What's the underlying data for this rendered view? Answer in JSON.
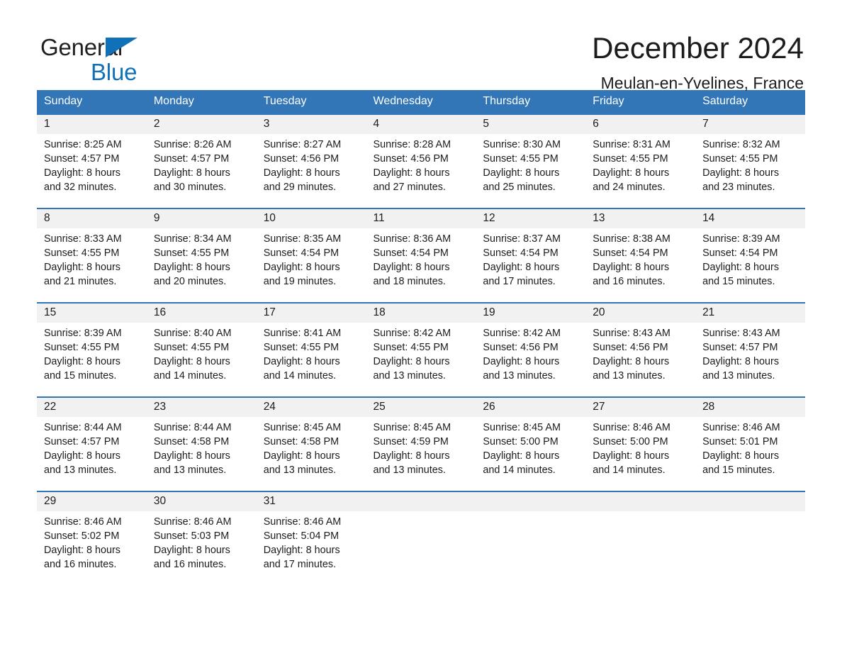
{
  "brand": {
    "line1": "General",
    "line2": "Blue",
    "triangle_icon": "triangle-icon",
    "accent_color": "#1070b8"
  },
  "header": {
    "month_title": "December 2024",
    "location": "Meulan-en-Yvelines, France"
  },
  "calendar": {
    "header_bg": "#3276b7",
    "daynum_bg": "#f1f1f1",
    "weekdays": [
      "Sunday",
      "Monday",
      "Tuesday",
      "Wednesday",
      "Thursday",
      "Friday",
      "Saturday"
    ],
    "labels": {
      "sunrise": "Sunrise:",
      "sunset": "Sunset:",
      "daylight": "Daylight:"
    },
    "weeks": [
      [
        {
          "day": "1",
          "sunrise": "Sunrise: 8:25 AM",
          "sunset": "Sunset: 4:57 PM",
          "daylight_line1": "Daylight: 8 hours",
          "daylight_line2": "and 32 minutes."
        },
        {
          "day": "2",
          "sunrise": "Sunrise: 8:26 AM",
          "sunset": "Sunset: 4:57 PM",
          "daylight_line1": "Daylight: 8 hours",
          "daylight_line2": "and 30 minutes."
        },
        {
          "day": "3",
          "sunrise": "Sunrise: 8:27 AM",
          "sunset": "Sunset: 4:56 PM",
          "daylight_line1": "Daylight: 8 hours",
          "daylight_line2": "and 29 minutes."
        },
        {
          "day": "4",
          "sunrise": "Sunrise: 8:28 AM",
          "sunset": "Sunset: 4:56 PM",
          "daylight_line1": "Daylight: 8 hours",
          "daylight_line2": "and 27 minutes."
        },
        {
          "day": "5",
          "sunrise": "Sunrise: 8:30 AM",
          "sunset": "Sunset: 4:55 PM",
          "daylight_line1": "Daylight: 8 hours",
          "daylight_line2": "and 25 minutes."
        },
        {
          "day": "6",
          "sunrise": "Sunrise: 8:31 AM",
          "sunset": "Sunset: 4:55 PM",
          "daylight_line1": "Daylight: 8 hours",
          "daylight_line2": "and 24 minutes."
        },
        {
          "day": "7",
          "sunrise": "Sunrise: 8:32 AM",
          "sunset": "Sunset: 4:55 PM",
          "daylight_line1": "Daylight: 8 hours",
          "daylight_line2": "and 23 minutes."
        }
      ],
      [
        {
          "day": "8",
          "sunrise": "Sunrise: 8:33 AM",
          "sunset": "Sunset: 4:55 PM",
          "daylight_line1": "Daylight: 8 hours",
          "daylight_line2": "and 21 minutes."
        },
        {
          "day": "9",
          "sunrise": "Sunrise: 8:34 AM",
          "sunset": "Sunset: 4:55 PM",
          "daylight_line1": "Daylight: 8 hours",
          "daylight_line2": "and 20 minutes."
        },
        {
          "day": "10",
          "sunrise": "Sunrise: 8:35 AM",
          "sunset": "Sunset: 4:54 PM",
          "daylight_line1": "Daylight: 8 hours",
          "daylight_line2": "and 19 minutes."
        },
        {
          "day": "11",
          "sunrise": "Sunrise: 8:36 AM",
          "sunset": "Sunset: 4:54 PM",
          "daylight_line1": "Daylight: 8 hours",
          "daylight_line2": "and 18 minutes."
        },
        {
          "day": "12",
          "sunrise": "Sunrise: 8:37 AM",
          "sunset": "Sunset: 4:54 PM",
          "daylight_line1": "Daylight: 8 hours",
          "daylight_line2": "and 17 minutes."
        },
        {
          "day": "13",
          "sunrise": "Sunrise: 8:38 AM",
          "sunset": "Sunset: 4:54 PM",
          "daylight_line1": "Daylight: 8 hours",
          "daylight_line2": "and 16 minutes."
        },
        {
          "day": "14",
          "sunrise": "Sunrise: 8:39 AM",
          "sunset": "Sunset: 4:54 PM",
          "daylight_line1": "Daylight: 8 hours",
          "daylight_line2": "and 15 minutes."
        }
      ],
      [
        {
          "day": "15",
          "sunrise": "Sunrise: 8:39 AM",
          "sunset": "Sunset: 4:55 PM",
          "daylight_line1": "Daylight: 8 hours",
          "daylight_line2": "and 15 minutes."
        },
        {
          "day": "16",
          "sunrise": "Sunrise: 8:40 AM",
          "sunset": "Sunset: 4:55 PM",
          "daylight_line1": "Daylight: 8 hours",
          "daylight_line2": "and 14 minutes."
        },
        {
          "day": "17",
          "sunrise": "Sunrise: 8:41 AM",
          "sunset": "Sunset: 4:55 PM",
          "daylight_line1": "Daylight: 8 hours",
          "daylight_line2": "and 14 minutes."
        },
        {
          "day": "18",
          "sunrise": "Sunrise: 8:42 AM",
          "sunset": "Sunset: 4:55 PM",
          "daylight_line1": "Daylight: 8 hours",
          "daylight_line2": "and 13 minutes."
        },
        {
          "day": "19",
          "sunrise": "Sunrise: 8:42 AM",
          "sunset": "Sunset: 4:56 PM",
          "daylight_line1": "Daylight: 8 hours",
          "daylight_line2": "and 13 minutes."
        },
        {
          "day": "20",
          "sunrise": "Sunrise: 8:43 AM",
          "sunset": "Sunset: 4:56 PM",
          "daylight_line1": "Daylight: 8 hours",
          "daylight_line2": "and 13 minutes."
        },
        {
          "day": "21",
          "sunrise": "Sunrise: 8:43 AM",
          "sunset": "Sunset: 4:57 PM",
          "daylight_line1": "Daylight: 8 hours",
          "daylight_line2": "and 13 minutes."
        }
      ],
      [
        {
          "day": "22",
          "sunrise": "Sunrise: 8:44 AM",
          "sunset": "Sunset: 4:57 PM",
          "daylight_line1": "Daylight: 8 hours",
          "daylight_line2": "and 13 minutes."
        },
        {
          "day": "23",
          "sunrise": "Sunrise: 8:44 AM",
          "sunset": "Sunset: 4:58 PM",
          "daylight_line1": "Daylight: 8 hours",
          "daylight_line2": "and 13 minutes."
        },
        {
          "day": "24",
          "sunrise": "Sunrise: 8:45 AM",
          "sunset": "Sunset: 4:58 PM",
          "daylight_line1": "Daylight: 8 hours",
          "daylight_line2": "and 13 minutes."
        },
        {
          "day": "25",
          "sunrise": "Sunrise: 8:45 AM",
          "sunset": "Sunset: 4:59 PM",
          "daylight_line1": "Daylight: 8 hours",
          "daylight_line2": "and 13 minutes."
        },
        {
          "day": "26",
          "sunrise": "Sunrise: 8:45 AM",
          "sunset": "Sunset: 5:00 PM",
          "daylight_line1": "Daylight: 8 hours",
          "daylight_line2": "and 14 minutes."
        },
        {
          "day": "27",
          "sunrise": "Sunrise: 8:46 AM",
          "sunset": "Sunset: 5:00 PM",
          "daylight_line1": "Daylight: 8 hours",
          "daylight_line2": "and 14 minutes."
        },
        {
          "day": "28",
          "sunrise": "Sunrise: 8:46 AM",
          "sunset": "Sunset: 5:01 PM",
          "daylight_line1": "Daylight: 8 hours",
          "daylight_line2": "and 15 minutes."
        }
      ],
      [
        {
          "day": "29",
          "sunrise": "Sunrise: 8:46 AM",
          "sunset": "Sunset: 5:02 PM",
          "daylight_line1": "Daylight: 8 hours",
          "daylight_line2": "and 16 minutes."
        },
        {
          "day": "30",
          "sunrise": "Sunrise: 8:46 AM",
          "sunset": "Sunset: 5:03 PM",
          "daylight_line1": "Daylight: 8 hours",
          "daylight_line2": "and 16 minutes."
        },
        {
          "day": "31",
          "sunrise": "Sunrise: 8:46 AM",
          "sunset": "Sunset: 5:04 PM",
          "daylight_line1": "Daylight: 8 hours",
          "daylight_line2": "and 17 minutes."
        },
        {
          "day": "",
          "sunrise": "",
          "sunset": "",
          "daylight_line1": "",
          "daylight_line2": ""
        },
        {
          "day": "",
          "sunrise": "",
          "sunset": "",
          "daylight_line1": "",
          "daylight_line2": ""
        },
        {
          "day": "",
          "sunrise": "",
          "sunset": "",
          "daylight_line1": "",
          "daylight_line2": ""
        },
        {
          "day": "",
          "sunrise": "",
          "sunset": "",
          "daylight_line1": "",
          "daylight_line2": ""
        }
      ]
    ]
  }
}
